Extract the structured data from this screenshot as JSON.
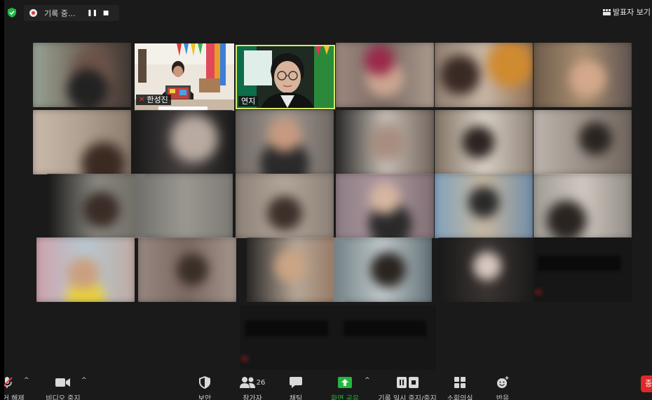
{
  "recording": {
    "status_label": "기록 중...",
    "pause_glyph": "❚❚",
    "stop_glyph": "■"
  },
  "view": {
    "speaker_view_label": "발표자 보기"
  },
  "participants": [
    {
      "name": "한성진",
      "muted": true
    },
    {
      "name": "연지",
      "muted": false,
      "active_speaker": true
    }
  ],
  "toolbar": {
    "mute_label": "음소거 해제",
    "video_label": "비디오 중지",
    "security_label": "보안",
    "participants_label": "참가자",
    "participants_count": "26",
    "chat_label": "채팅",
    "share_label": "화면 공유",
    "record_label": "기록 일시 중지/중지",
    "breakout_label": "소회의실",
    "reactions_label": "반응",
    "end_label": "종료"
  },
  "colors": {
    "accent_green": "#22b83e",
    "active_speaker_border": "#d4ec6a",
    "end_red": "#e02828",
    "shield_green": "#1fb74a"
  }
}
